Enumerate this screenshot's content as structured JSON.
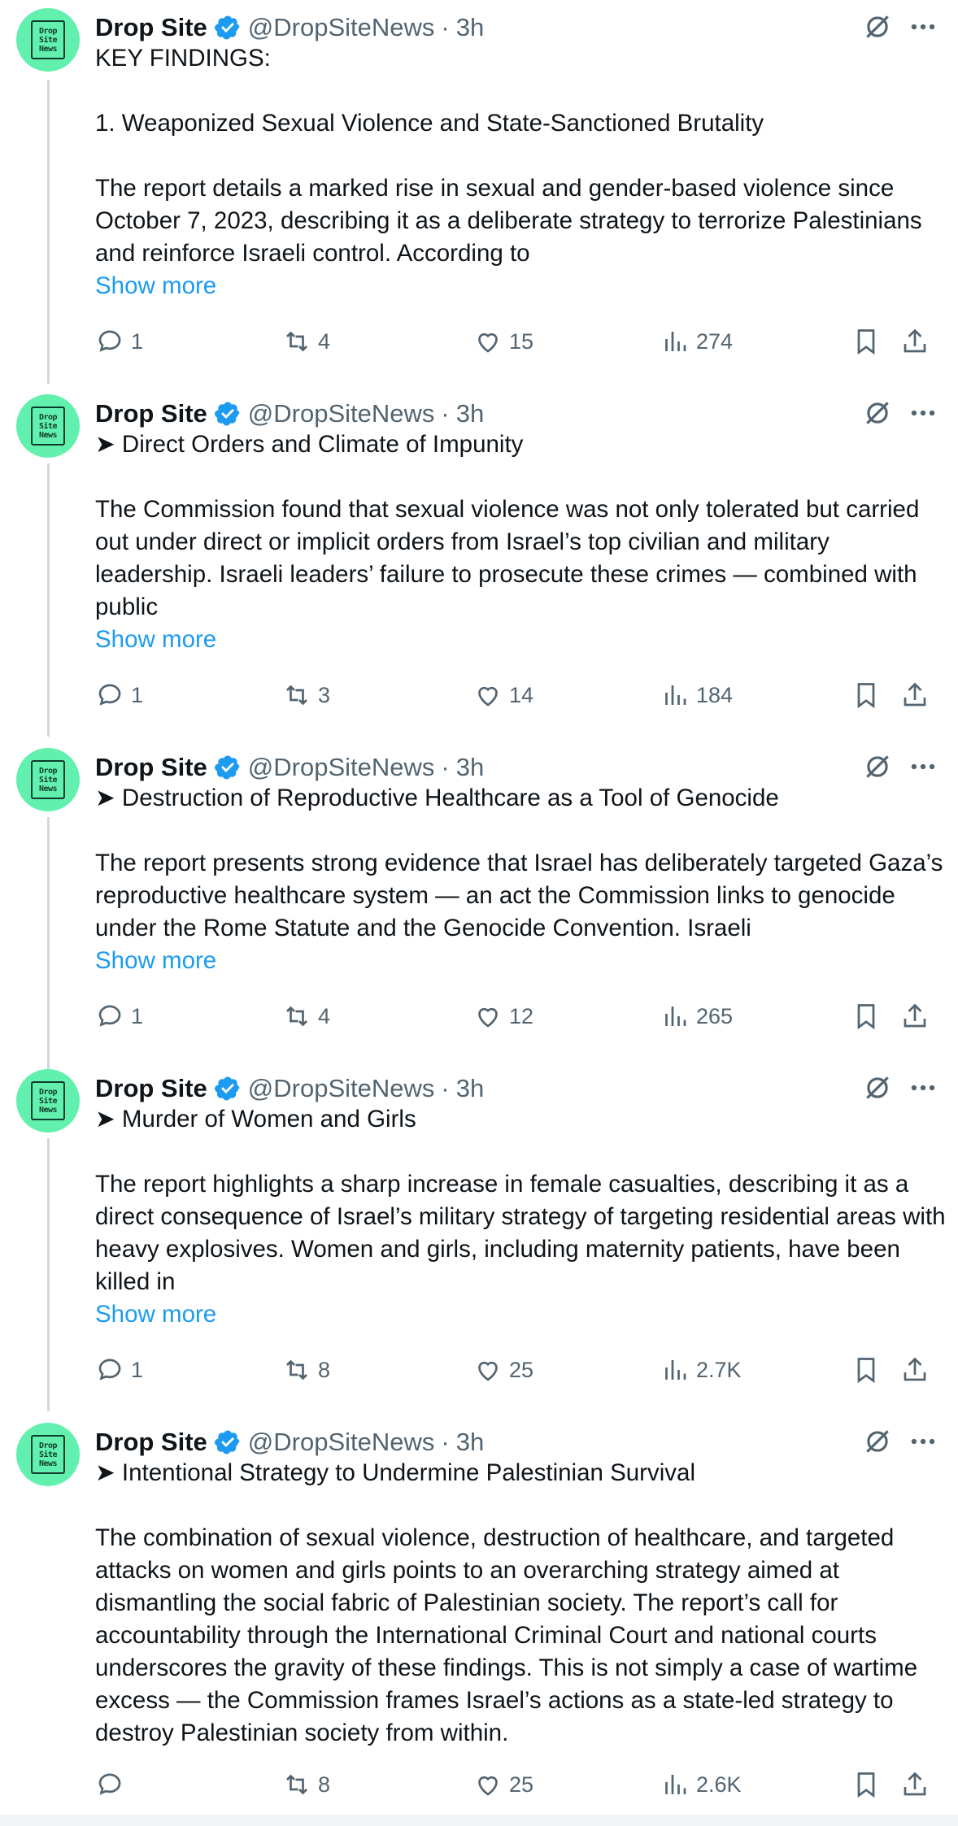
{
  "colors": {
    "link": "#1d9bf0",
    "secondary": "#536471",
    "avatar_bg": "#62f0ae",
    "verified": "#1d9bf0",
    "thread_line": "#cfd9de"
  },
  "tweets": [
    {
      "name": "Drop Site",
      "handle": "@DropSiteNews",
      "dot": "·",
      "time": "3h",
      "avatar_text": [
        "Drop",
        "Site",
        "News"
      ],
      "text": "KEY FINDINGS:\n\n1. Weaponized Sexual Violence and State-Sanctioned Brutality\n\nThe report details a marked rise in sexual and gender-based violence since October 7, 2023, describing it as a deliberate strategy to terrorize Palestinians and reinforce Israeli control. According to",
      "show_more": "Show more",
      "replies": "1",
      "reposts": "4",
      "likes": "15",
      "views": "274"
    },
    {
      "name": "Drop Site",
      "handle": "@DropSiteNews",
      "dot": "·",
      "time": "3h",
      "avatar_text": [
        "Drop",
        "Site",
        "News"
      ],
      "text": "➤ Direct Orders and Climate of Impunity\n\nThe Commission found that sexual violence was not only tolerated but carried out under direct or implicit orders from Israel’s top civilian and military leadership. Israeli leaders’ failure to prosecute these crimes — combined with public",
      "show_more": "Show more",
      "replies": "1",
      "reposts": "3",
      "likes": "14",
      "views": "184"
    },
    {
      "name": "Drop Site",
      "handle": "@DropSiteNews",
      "dot": "·",
      "time": "3h",
      "avatar_text": [
        "Drop",
        "Site",
        "News"
      ],
      "text": "➤ Destruction of Reproductive Healthcare as a Tool of Genocide\n\nThe report presents strong evidence that Israel has deliberately targeted Gaza’s reproductive healthcare system — an act the Commission links to genocide under the Rome Statute and the Genocide Convention. Israeli",
      "show_more": "Show more",
      "replies": "1",
      "reposts": "4",
      "likes": "12",
      "views": "265"
    },
    {
      "name": "Drop Site",
      "handle": "@DropSiteNews",
      "dot": "·",
      "time": "3h",
      "avatar_text": [
        "Drop",
        "Site",
        "News"
      ],
      "text": "➤ Murder of Women and Girls\n\nThe report highlights a sharp increase in female casualties, describing it as a direct consequence of Israel’s military strategy of targeting residential areas with heavy explosives. Women and girls, including maternity patients, have been killed in",
      "show_more": "Show more",
      "replies": "1",
      "reposts": "8",
      "likes": "25",
      "views": "2.7K"
    },
    {
      "name": "Drop Site",
      "handle": "@DropSiteNews",
      "dot": "·",
      "time": "3h",
      "avatar_text": [
        "Drop",
        "Site",
        "News"
      ],
      "text": "➤ Intentional Strategy to Undermine Palestinian Survival\n\nThe combination of sexual violence, destruction of healthcare, and targeted attacks on women and girls points to an overarching strategy aimed at dismantling the social fabric of Palestinian society. The report’s call for accountability through the International Criminal Court and national courts underscores the gravity of these findings. This is not simply a case of wartime excess — the Commission frames Israel’s actions as a state-led strategy to destroy Palestinian society from within.",
      "show_more": "",
      "replies": "",
      "reposts": "8",
      "likes": "25",
      "views": "2.6K"
    }
  ],
  "icons": {
    "verified": "verified-badge-icon",
    "grok": "grok-icon",
    "more": "more-options-icon",
    "reply": "reply-icon",
    "repost": "repost-icon",
    "like": "like-icon",
    "views": "views-icon",
    "bookmark": "bookmark-icon",
    "share": "share-icon"
  }
}
